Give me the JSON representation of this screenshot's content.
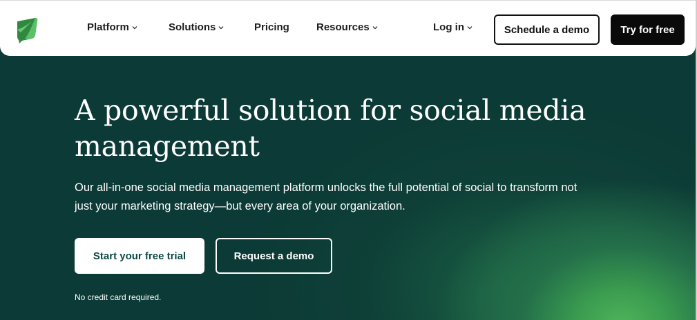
{
  "nav": {
    "items": [
      {
        "label": "Platform",
        "has_dropdown": true
      },
      {
        "label": "Solutions",
        "has_dropdown": true
      },
      {
        "label": "Pricing",
        "has_dropdown": false
      },
      {
        "label": "Resources",
        "has_dropdown": true
      }
    ],
    "login_label": "Log in",
    "schedule_demo_label": "Schedule a demo",
    "try_free_label": "Try for free"
  },
  "hero": {
    "headline_line1": "A powerful solution for social media",
    "headline_line2": "management",
    "subtext_line1": "Our all-in-one social media management platform unlocks the full potential of social to transform not",
    "subtext_line2": "just your marketing strategy—but every area of your organization.",
    "primary_cta": "Start your free trial",
    "secondary_cta": "Request a demo",
    "note": "No credit card required."
  },
  "colors": {
    "hero_bg": "#0c3a36",
    "accent_green": "#4fb35a",
    "cta_text": "#0d4a45"
  }
}
